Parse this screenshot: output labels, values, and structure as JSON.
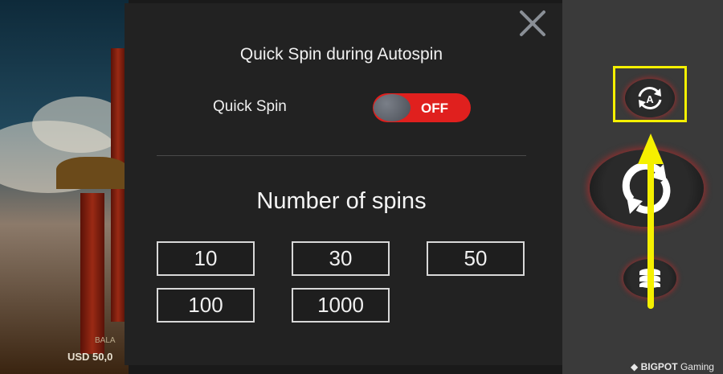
{
  "modal": {
    "title": "Quick Spin during Autospin",
    "quick_spin_label": "Quick Spin",
    "toggle_state": "OFF",
    "spins_title": "Number of spins",
    "spin_options": [
      "10",
      "30",
      "50",
      "100",
      "1000"
    ]
  },
  "game": {
    "balance_label": "BALA",
    "balance_value": "USD 50,0"
  },
  "brand": {
    "name": "BIGPOT",
    "suffix": "Gaming"
  },
  "icons": {
    "close": "close-icon",
    "autospin": "autospin-icon",
    "spin": "spin-icon",
    "coins": "coin-stack-icon"
  },
  "colors": {
    "toggle_off": "#e0201e",
    "highlight": "#f5f000",
    "panel": "#222222"
  }
}
